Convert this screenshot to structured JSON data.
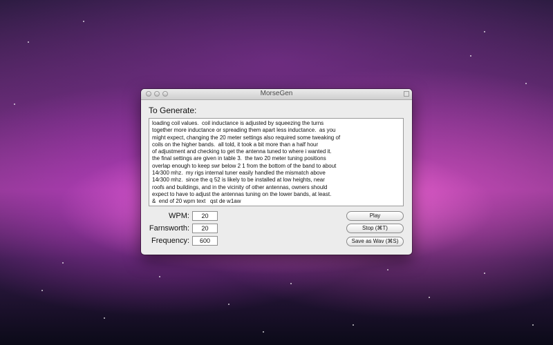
{
  "window": {
    "title": "MorseGen"
  },
  "generate": {
    "label": "To Generate:",
    "lines": [
      "loading coil values.  coil inductance is adjusted by squeezing the turns",
      "together more inductance or spreading them apart less inductance.  as you",
      "might expect, changing the 20 meter settings also required some tweaking of",
      "coils on the higher bands.  all told, it took a bit more than a half hour",
      "of adjustment and checking to get the antenna tuned to where i wanted it.",
      "the final settings are given in table 3.  the two 20 meter tuning positions",
      "overlap enough to keep swr below 2 1 from the bottom of the band to about",
      "14r300 mhz.  my rigs internal tuner easily handled the mismatch above",
      "14r300 mhz.  since the q 52 is likely to be installed at low heights, near",
      "roofs and buildings, and in the vicinity of other antennas, owners should",
      "expect to have to adjust the antennas tuning on the lower bands, at least.",
      "&  end of 20 wpm text   qst de w1aw"
    ]
  },
  "fields": {
    "wpm": {
      "label": "WPM:",
      "value": "20"
    },
    "farnsworth": {
      "label": "Farnsworth:",
      "value": "20"
    },
    "frequency": {
      "label": "Frequency:",
      "value": "600"
    }
  },
  "buttons": {
    "play": "Play",
    "stop": "Stop (⌘T)",
    "save": "Save as Wav (⌘S)"
  }
}
